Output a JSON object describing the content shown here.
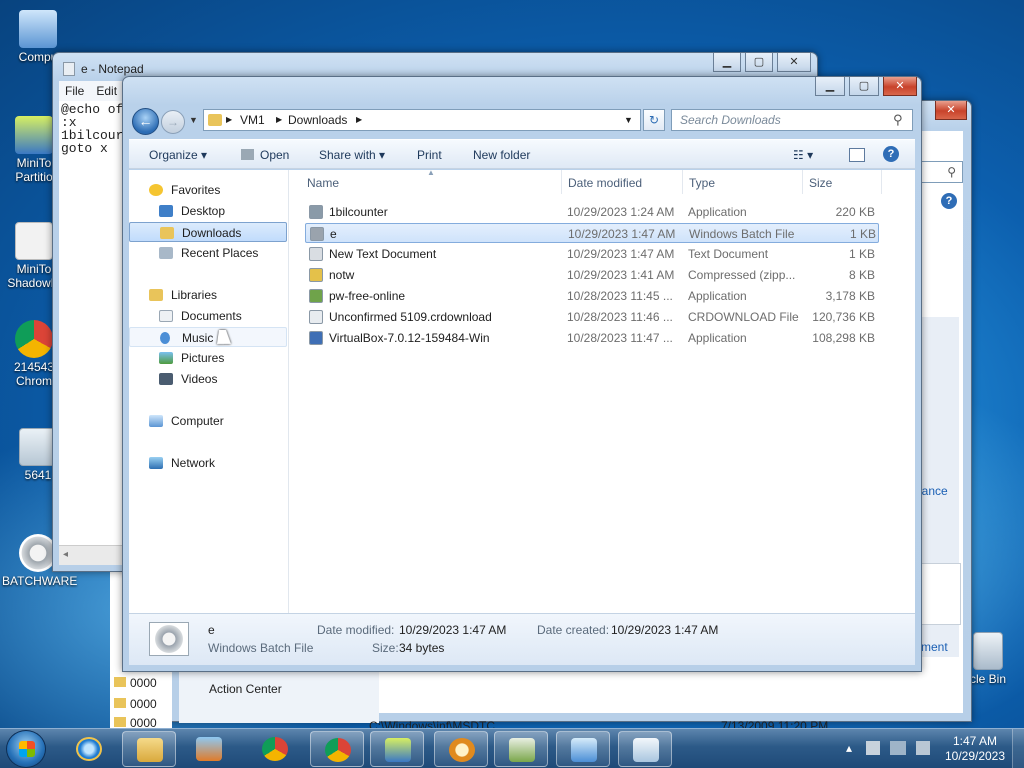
{
  "desktop": {
    "icons": [
      {
        "label": "Compu",
        "color": "#7fb0e0"
      },
      {
        "label": "MiniTo\nPartitio",
        "color": "#4a8ad0"
      },
      {
        "label": "MiniTo\nShadowM",
        "color": "#e7e7e7"
      },
      {
        "label": "214543\nChrom",
        "color": "#e04a3a"
      },
      {
        "label": "5641",
        "color": "#d9e3ea"
      },
      {
        "label": "BATCHWARE",
        "color": "#d0d4d8"
      },
      {
        "label": "cle Bin",
        "color": "#c9d4de"
      }
    ]
  },
  "notepad": {
    "title": "e - Notepad",
    "menu": [
      "File",
      "Edit"
    ],
    "content": "@echo of\n:x\n1bilcour\ngoto x"
  },
  "backwin": {
    "action_center": "Action Center",
    "link_maintenance": "nance",
    "link_troubleshoot": "sment",
    "letter": "e",
    "path": "C:\\Windows\\inf\\MSDTC",
    "date": "7/13/2009 11:20 PM",
    "folders": [
      "0000",
      "0000",
      "0000"
    ]
  },
  "explorer": {
    "breadcrumb": [
      "VM1",
      "Downloads"
    ],
    "search_placeholder": "Search Downloads",
    "toolbar": {
      "organize": "Organize",
      "open": "Open",
      "share_with": "Share with",
      "print": "Print",
      "new_folder": "New folder"
    },
    "nav": {
      "favorites": "Favorites",
      "desktop": "Desktop",
      "downloads": "Downloads",
      "recent_places": "Recent Places",
      "libraries": "Libraries",
      "documents": "Documents",
      "music": "Music",
      "pictures": "Pictures",
      "videos": "Videos",
      "computer": "Computer",
      "network": "Network"
    },
    "columns": {
      "name": "Name",
      "date": "Date modified",
      "type": "Type",
      "size": "Size"
    },
    "files": [
      {
        "name": "1bilcounter",
        "date": "10/29/2023 1:24 AM",
        "type": "Application",
        "size": "220 KB",
        "icon_color": "#8a9aa8"
      },
      {
        "name": "e",
        "date": "10/29/2023 1:47 AM",
        "type": "Windows Batch File",
        "size": "1 KB",
        "icon_color": "#9aa3ad"
      },
      {
        "name": "New Text Document",
        "date": "10/29/2023 1:47 AM",
        "type": "Text Document",
        "size": "1 KB",
        "icon_color": "#d9dde2"
      },
      {
        "name": "notw",
        "date": "10/29/2023 1:41 AM",
        "type": "Compressed (zipp...",
        "size": "8 KB",
        "icon_color": "#e4c14a"
      },
      {
        "name": "pw-free-online",
        "date": "10/28/2023 11:45 ...",
        "type": "Application",
        "size": "3,178 KB",
        "icon_color": "#6fa34a"
      },
      {
        "name": "Unconfirmed 5109.crdownload",
        "date": "10/28/2023 11:46 ...",
        "type": "CRDOWNLOAD File",
        "size": "120,736 KB",
        "icon_color": "#e8ecf0"
      },
      {
        "name": "VirtualBox-7.0.12-159484-Win",
        "date": "10/28/2023 11:47 ...",
        "type": "Application",
        "size": "108,298 KB",
        "icon_color": "#3f6fb5"
      }
    ],
    "details": {
      "name": "e",
      "type": "Windows Batch File",
      "date_modified_label": "Date modified:",
      "date_modified": "10/29/2023 1:47 AM",
      "date_created_label": "Date created:",
      "date_created": "10/29/2023 1:47 AM",
      "size_label": "Size:",
      "size": "34 bytes"
    }
  },
  "taskbar": {
    "time": "1:47 AM",
    "date": "10/29/2023"
  }
}
